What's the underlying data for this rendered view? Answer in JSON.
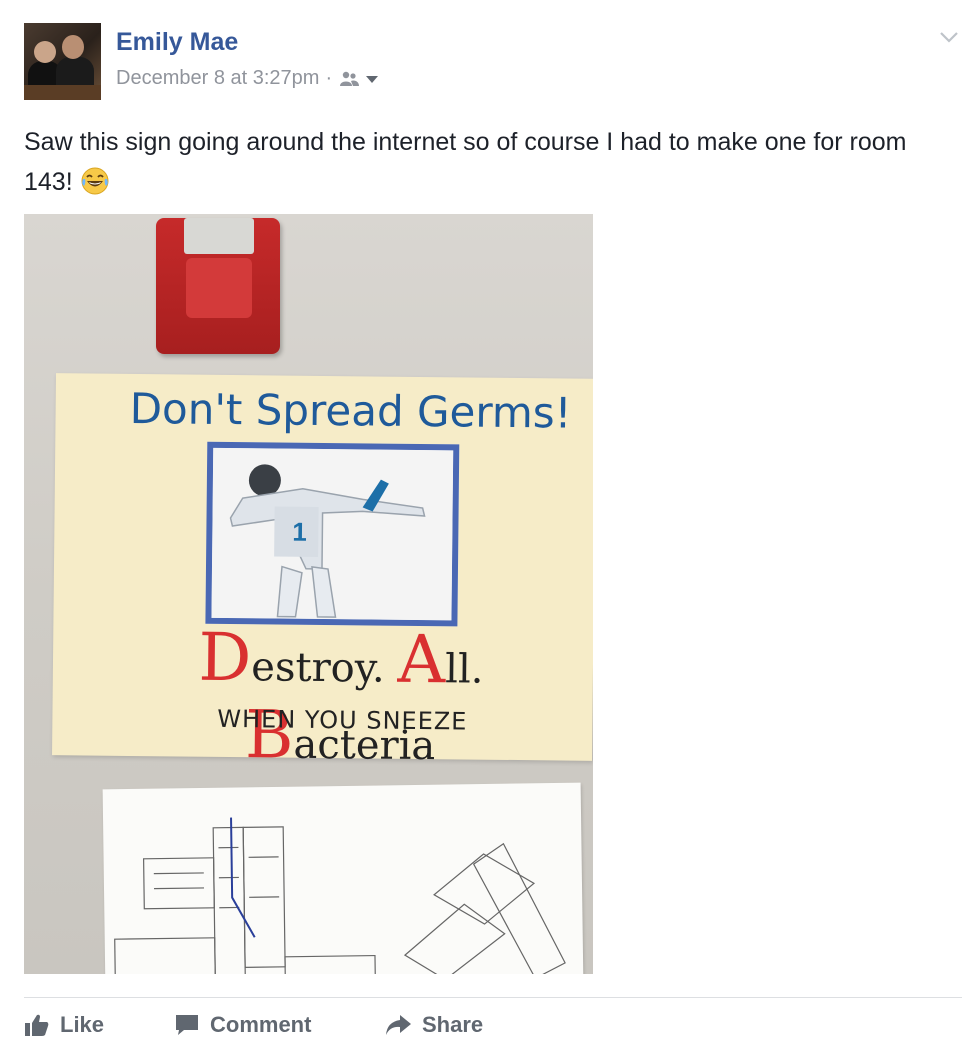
{
  "post": {
    "author": "Emily Mae",
    "timestamp": "December 8 at 3:27pm",
    "separator": "·",
    "text": "Saw this sign going around the internet so of course I had to make one for room 143!"
  },
  "photo": {
    "poster_title": "Don't Spread Germs!",
    "destroy": {
      "d_big": "D",
      "d_rest": "estroy.",
      "a_big": "A",
      "a_rest": "ll.",
      "b_big": "B",
      "b_rest": "acteria"
    },
    "sneeze": "WHEN YOU SNEEZE"
  },
  "actions": {
    "like": "Like",
    "comment": "Comment",
    "share": "Share"
  },
  "icons": {
    "audience": "friends-audience-icon",
    "emoji": "laughing-tears-emoji",
    "menu": "chevron-down-icon"
  },
  "colors": {
    "author_link": "#365899",
    "meta_grey": "#90949c",
    "action_grey": "#606770"
  }
}
